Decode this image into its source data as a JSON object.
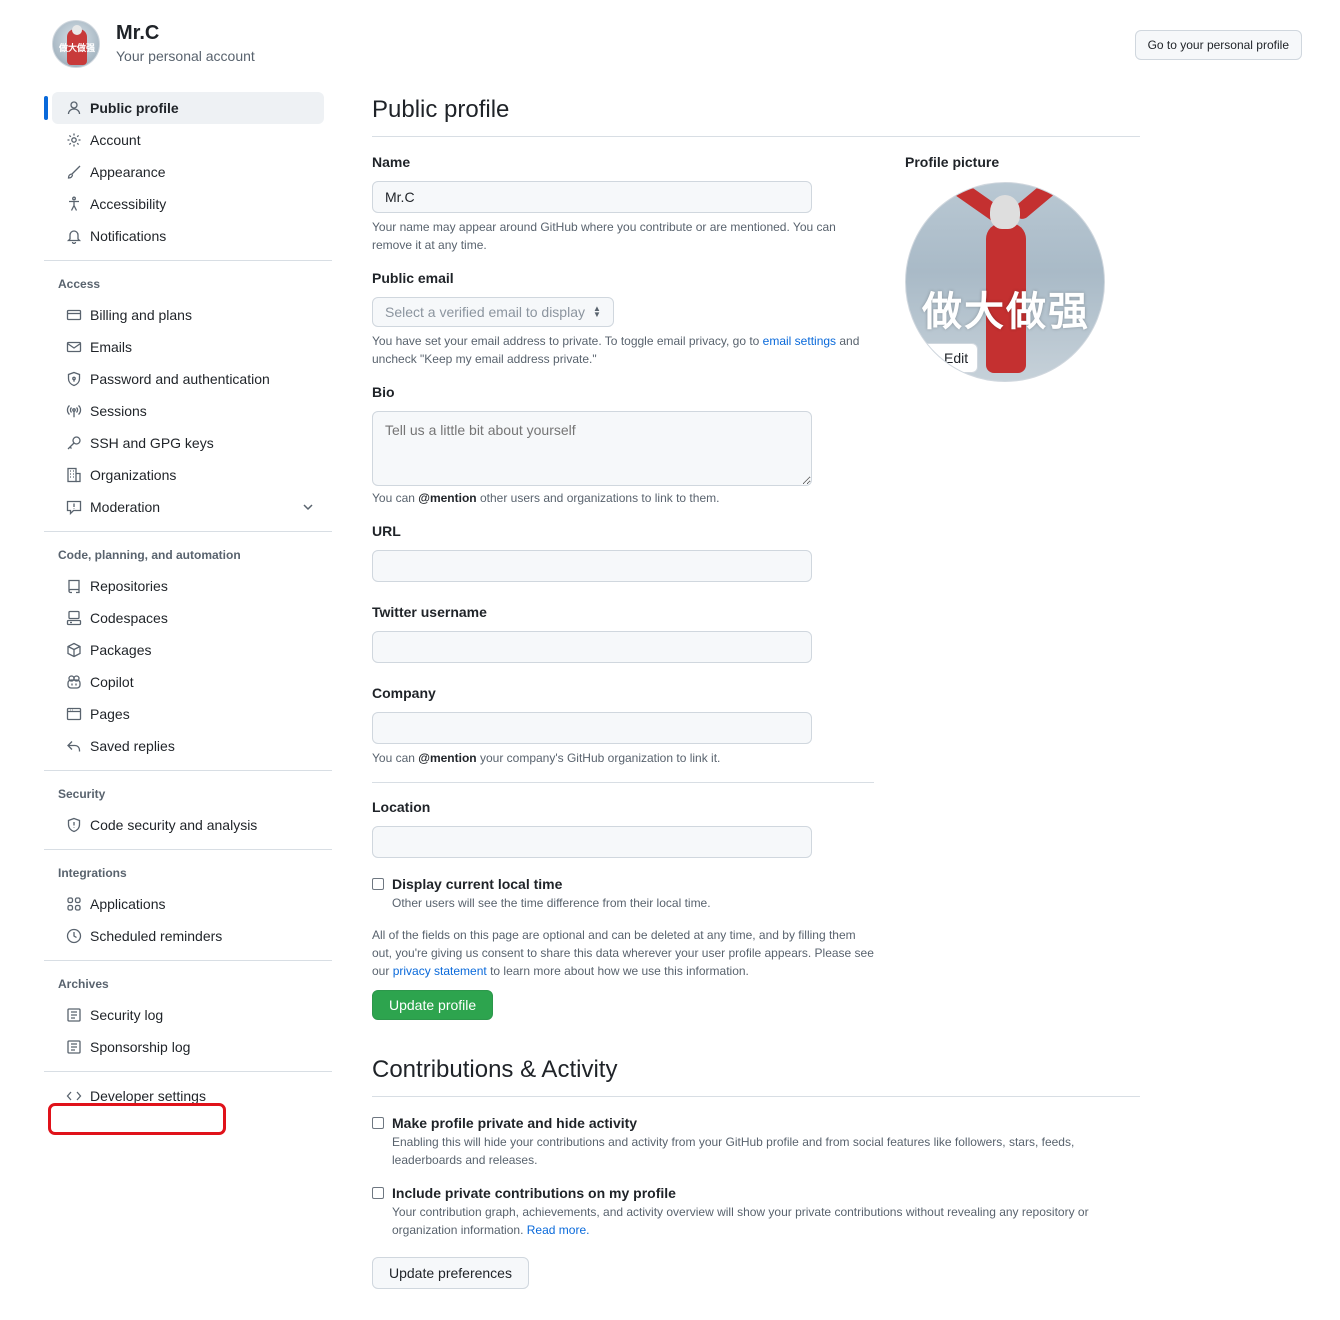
{
  "header": {
    "user_name": "Mr.C",
    "user_subtitle": "Your personal account",
    "avatar_caption": "做大做强",
    "profile_button": "Go to your personal profile"
  },
  "sidebar": {
    "items": [
      {
        "label": "Public profile",
        "icon": "person-icon"
      },
      {
        "label": "Account",
        "icon": "gear-icon"
      },
      {
        "label": "Appearance",
        "icon": "paintbrush-icon"
      },
      {
        "label": "Accessibility",
        "icon": "accessibility-icon"
      },
      {
        "label": "Notifications",
        "icon": "bell-icon"
      }
    ],
    "access_title": "Access",
    "access": [
      {
        "label": "Billing and plans",
        "icon": "credit-card-icon"
      },
      {
        "label": "Emails",
        "icon": "mail-icon"
      },
      {
        "label": "Password and authentication",
        "icon": "shield-lock-icon"
      },
      {
        "label": "Sessions",
        "icon": "broadcast-icon"
      },
      {
        "label": "SSH and GPG keys",
        "icon": "key-icon"
      },
      {
        "label": "Organizations",
        "icon": "organization-icon"
      },
      {
        "label": "Moderation",
        "icon": "report-icon"
      }
    ],
    "code_title": "Code, planning, and automation",
    "code": [
      {
        "label": "Repositories",
        "icon": "repo-icon"
      },
      {
        "label": "Codespaces",
        "icon": "codespaces-icon"
      },
      {
        "label": "Packages",
        "icon": "package-icon"
      },
      {
        "label": "Copilot",
        "icon": "copilot-icon"
      },
      {
        "label": "Pages",
        "icon": "browser-icon"
      },
      {
        "label": "Saved replies",
        "icon": "reply-icon"
      }
    ],
    "security_title": "Security",
    "security": [
      {
        "label": "Code security and analysis",
        "icon": "codescan-icon"
      }
    ],
    "integrations_title": "Integrations",
    "integrations": [
      {
        "label": "Applications",
        "icon": "apps-icon"
      },
      {
        "label": "Scheduled reminders",
        "icon": "clock-icon"
      }
    ],
    "archives_title": "Archives",
    "archives": [
      {
        "label": "Security log",
        "icon": "log-icon"
      },
      {
        "label": "Sponsorship log",
        "icon": "log-icon"
      }
    ],
    "developer_settings": "Developer settings"
  },
  "main": {
    "title": "Public profile",
    "name_label": "Name",
    "name_value": "Mr.C",
    "name_note": "Your name may appear around GitHub where you contribute or are mentioned. You can remove it at any time.",
    "email_label": "Public email",
    "email_placeholder": "Select a verified email to display",
    "email_note_pre": "You have set your email address to private. To toggle email privacy, go to ",
    "email_note_link": "email settings",
    "email_note_post": " and uncheck \"Keep my email address private.\"",
    "bio_label": "Bio",
    "bio_placeholder": "Tell us a little bit about yourself",
    "bio_note_pre": "You can ",
    "bio_note_bold": "@mention",
    "bio_note_post": " other users and organizations to link to them.",
    "url_label": "URL",
    "twitter_label": "Twitter username",
    "company_label": "Company",
    "company_note_pre": "You can ",
    "company_note_bold": "@mention",
    "company_note_post": " your company's GitHub organization to link it.",
    "location_label": "Location",
    "local_time_label": "Display current local time",
    "local_time_note": "Other users will see the time difference from their local time.",
    "consent_pre": "All of the fields on this page are optional and can be deleted at any time, and by filling them out, you're giving us consent to share this data wherever your user profile appears. Please see our ",
    "consent_link": "privacy statement",
    "consent_post": " to learn more about how we use this information.",
    "update_button": "Update profile",
    "picture_label": "Profile picture",
    "picture_caption": "做大做强",
    "edit_button": "Edit"
  },
  "contributions": {
    "title": "Contributions & Activity",
    "private_label": "Make profile private and hide activity",
    "private_note": "Enabling this will hide your contributions and activity from your GitHub profile and from social features like followers, stars, feeds, leaderboards and releases.",
    "include_label": "Include private contributions on my profile",
    "include_note_pre": "Your contribution graph, achievements, and activity overview will show your private contributions without revealing any repository or organization information. ",
    "include_note_link": "Read more.",
    "update_button": "Update preferences"
  },
  "colors": {
    "accent": "#0969da",
    "primary_button": "#2da44e",
    "highlight": "#e0121a"
  }
}
